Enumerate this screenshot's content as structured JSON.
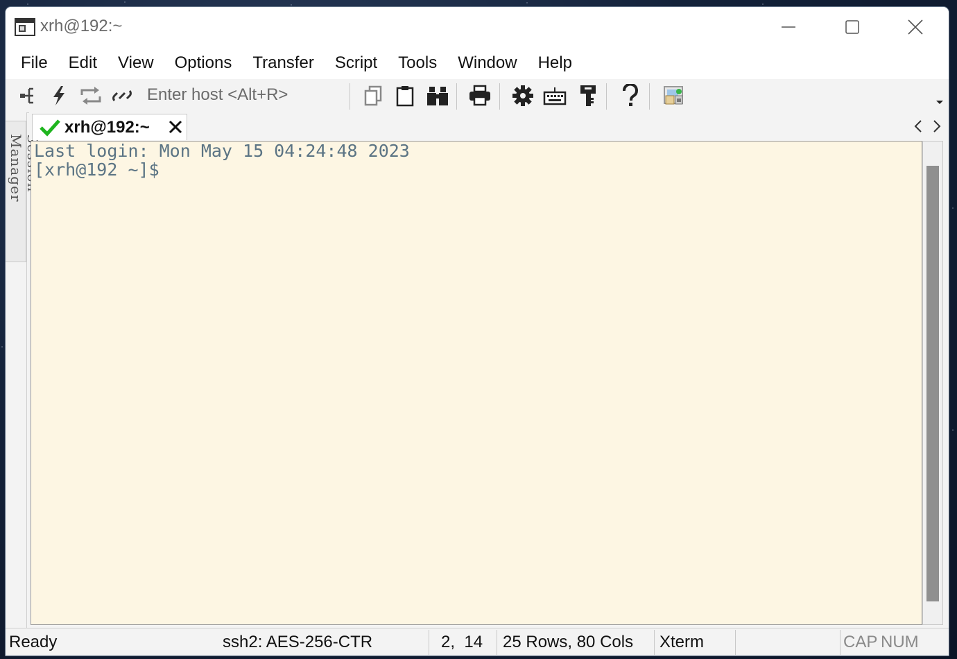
{
  "window": {
    "title": "xrh@192:~"
  },
  "menu": [
    "File",
    "Edit",
    "View",
    "Options",
    "Transfer",
    "Script",
    "Tools",
    "Window",
    "Help"
  ],
  "toolbar": {
    "host_placeholder": "Enter host <Alt+R>",
    "icons": [
      "connect-in-tab-icon",
      "quick-connect-icon",
      "reconnect-icon",
      "disconnect-icon",
      "copy-icon",
      "paste-icon",
      "find-icon",
      "print-icon",
      "session-options-icon",
      "keymap-editor-icon",
      "key-manager-icon",
      "help-icon",
      "sftp-icon"
    ]
  },
  "session_manager": {
    "label": "Session Manager"
  },
  "tab": {
    "title": "xrh@192:~",
    "status_color": "#1fb51f"
  },
  "terminal": {
    "lines": [
      "Last login: Mon May 15 04:24:48 2023",
      "[xrh@192 ~]$ "
    ],
    "background": "#fdf6e3",
    "foreground": "#5b7484"
  },
  "status": {
    "ready": "Ready",
    "cipher": "ssh2: AES-256-CTR",
    "cursor": "2,  14",
    "size": "25 Rows, 80 Cols",
    "terminal_type": "Xterm",
    "caps": "CAP",
    "num": "NUM"
  }
}
